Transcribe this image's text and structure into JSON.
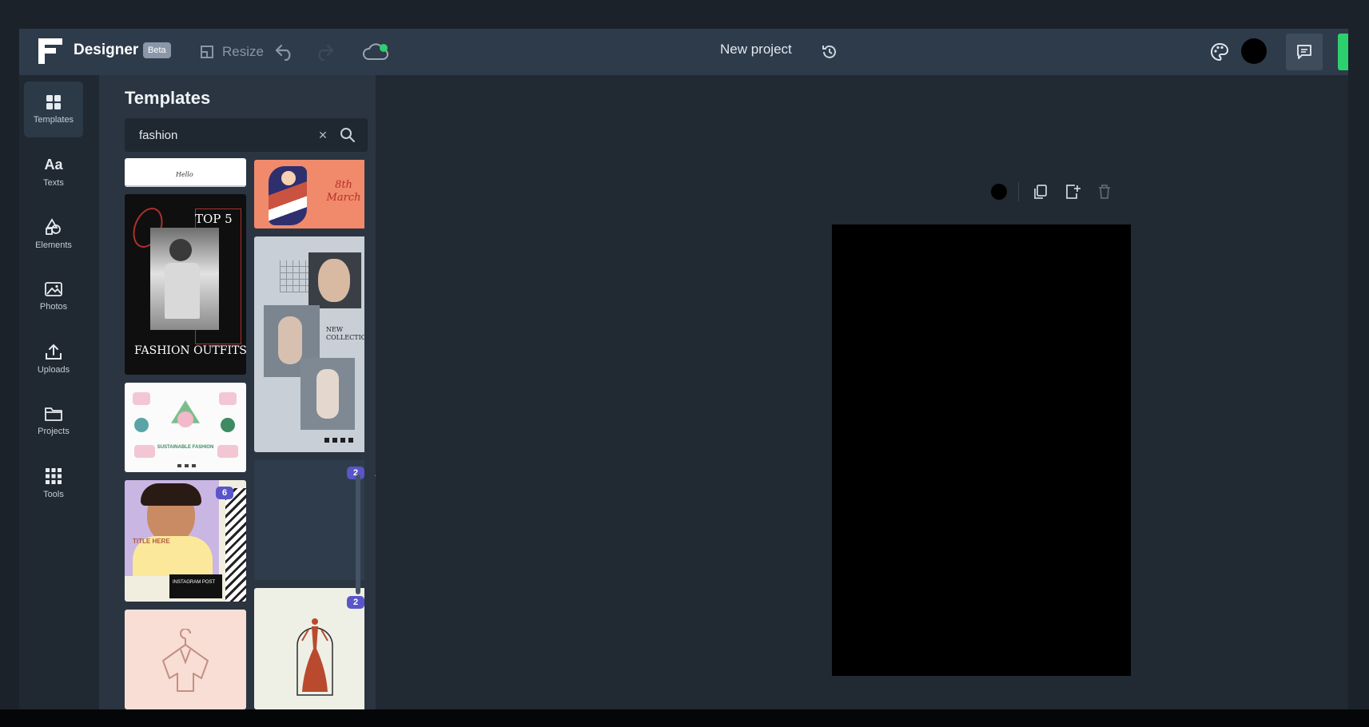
{
  "app": {
    "name": "Designer",
    "badge": "Beta"
  },
  "toolbar": {
    "resize_label": "Resize",
    "project_title": "New project",
    "current_color": "#000000"
  },
  "nav": {
    "items": [
      {
        "label": "Templates",
        "icon": "templates-icon",
        "active": true
      },
      {
        "label": "Texts",
        "icon": "texts-icon",
        "active": false
      },
      {
        "label": "Elements",
        "icon": "elements-icon",
        "active": false
      },
      {
        "label": "Photos",
        "icon": "photos-icon",
        "active": false
      },
      {
        "label": "Uploads",
        "icon": "uploads-icon",
        "active": false
      },
      {
        "label": "Projects",
        "icon": "projects-icon",
        "active": false
      },
      {
        "label": "Tools",
        "icon": "tools-icon",
        "active": false
      }
    ]
  },
  "panel": {
    "title": "Templates",
    "search_value": "fashion",
    "templates": [
      {
        "id": "t-white-strip",
        "text": "Hello"
      },
      {
        "id": "t-8th-march",
        "text": "8th March"
      },
      {
        "id": "t-fashion-outfits",
        "text_top": "TOP 5",
        "text_bottom": "FASHION OUTFITS"
      },
      {
        "id": "t-new-collection",
        "text": "NEW COLLECTION"
      },
      {
        "id": "t-sustainable",
        "text": "SUSTAINABLE FASHION"
      },
      {
        "id": "t-loading",
        "badge": "2"
      },
      {
        "id": "t-instagram",
        "badge": "6",
        "text": "TITLE HERE",
        "text2": "INSTAGRAM POST"
      },
      {
        "id": "t-hanger",
        "text": ""
      },
      {
        "id": "t-dress",
        "badge": "2"
      }
    ]
  },
  "colors": {
    "accent_green": "#2dd06e",
    "badge_purple": "#5a55c9",
    "topbar": "#2e3b4a"
  }
}
